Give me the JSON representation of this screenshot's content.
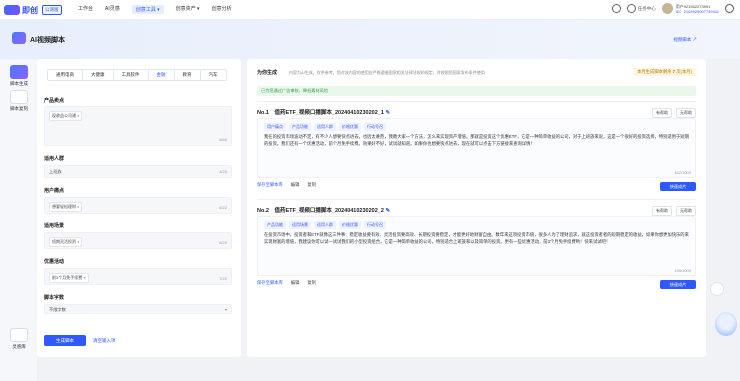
{
  "topbar": {
    "logo_text": "即创",
    "badge": "公测版",
    "nav": [
      "工作台",
      "AI灵感",
      "创意工具 ▾",
      "创意资产 ▾",
      "创意分析"
    ],
    "service": "任务中心",
    "user_name": "用户921552273991",
    "user_id": "ID：2104929007739311"
  },
  "subheader": {
    "title": "AI视频脚本",
    "link": "视频脚本 ↗"
  },
  "sidebar": {
    "items": [
      "脚本生成",
      "脚本复刻",
      "灵感库"
    ]
  },
  "form": {
    "tabs": [
      "通用电商",
      "大健康",
      "工具软件",
      "金融",
      "教育",
      "汽车"
    ],
    "active_tab": "金融",
    "product_label": "产品卖点",
    "product_chip": "现收益公司通 ×",
    "product_count": "6/60",
    "audience_label": "适用人群",
    "audience_value": "上班族",
    "audience_count": "3/20",
    "pain_label": "用户痛点",
    "pain_chip": "想要轻松理财 ×",
    "pain_count": "6/22",
    "scene_label": "适用场景",
    "scene_chip": "短期灵活投资 ×",
    "scene_count": "6/22",
    "promo_label": "优惠活动",
    "promo_chip": "前3个月免手续费 ×",
    "promo_count": "7/22",
    "words_label": "脚本字数",
    "words_value": "不限字数",
    "generate_btn": "生成脚本",
    "clear_btn": "清空输入项"
  },
  "output": {
    "why_title": "为你生成",
    "why_desc": "内容为AI生成，仅供参考，您对该内容的使用应严格遵循国家相关法律法规的规定，并按照您国家发布条件使用",
    "remain_prefix": "本月生成脚本剩余",
    "remain_value": "7",
    "remain_suffix": "次(本月)",
    "notice": "已为您通过广告审核，降低素材风险",
    "results": [
      {
        "num": "No.1",
        "title": "值药ETF_视频口播脚本_20240410230202_1",
        "tags": [
          "用户痛点",
          "产品功能",
          "适用人群",
          "价格优惠",
          "行动号召"
        ],
        "content": "我在的投资市场波动不定，有不少人想要快点进去，也因太难熬，我教大家一个方法，怎么来实现资产增值。那就是投资这个优惠ETF，它是一种简单收益的公司，对于上班族来说，这是一个很好的投资选择，特别适用于短期的投资。我们还有一个优惠活动，前个月免手续费。效果好不好，试试就知道。如果你也想要快点进去，现在就可以点击下方链接来查询详情！",
        "count": "162/1000",
        "actions": [
          "保存至脚本库",
          "编辑",
          "复制"
        ],
        "btn": "快速成片"
      },
      {
        "num": "No.2",
        "title": "值药ETF_视频口播脚本_20240410230202_2",
        "tags": [
          "产品功能",
          "适用场景",
          "适用人群",
          "价格优惠",
          "行动号召"
        ],
        "content": "在投资市场中，投资者和ETF就像这三件事：稳定收益要有效、灵活投资要高效、长期投资要稳定，才能更好地财富自由。数年来这项投资市值，很多人为了理财追求，就这投资者者的短期稳定的收益。如果你想更加快乐的来实现财富的增值，我建议你可以试一试试我们的小型投资组合，它是一种简单收益的公司，特别适合上班族和以及简单的投资。更有一些优惠活动，前3个月免手续费哟！快来试试吧！",
        "count": "195/1000",
        "actions": [
          "保存至脚本库",
          "编辑",
          "复制"
        ],
        "btn": "快速成片"
      }
    ],
    "help_label": "有帮助",
    "nohelp_label": "无帮助"
  }
}
